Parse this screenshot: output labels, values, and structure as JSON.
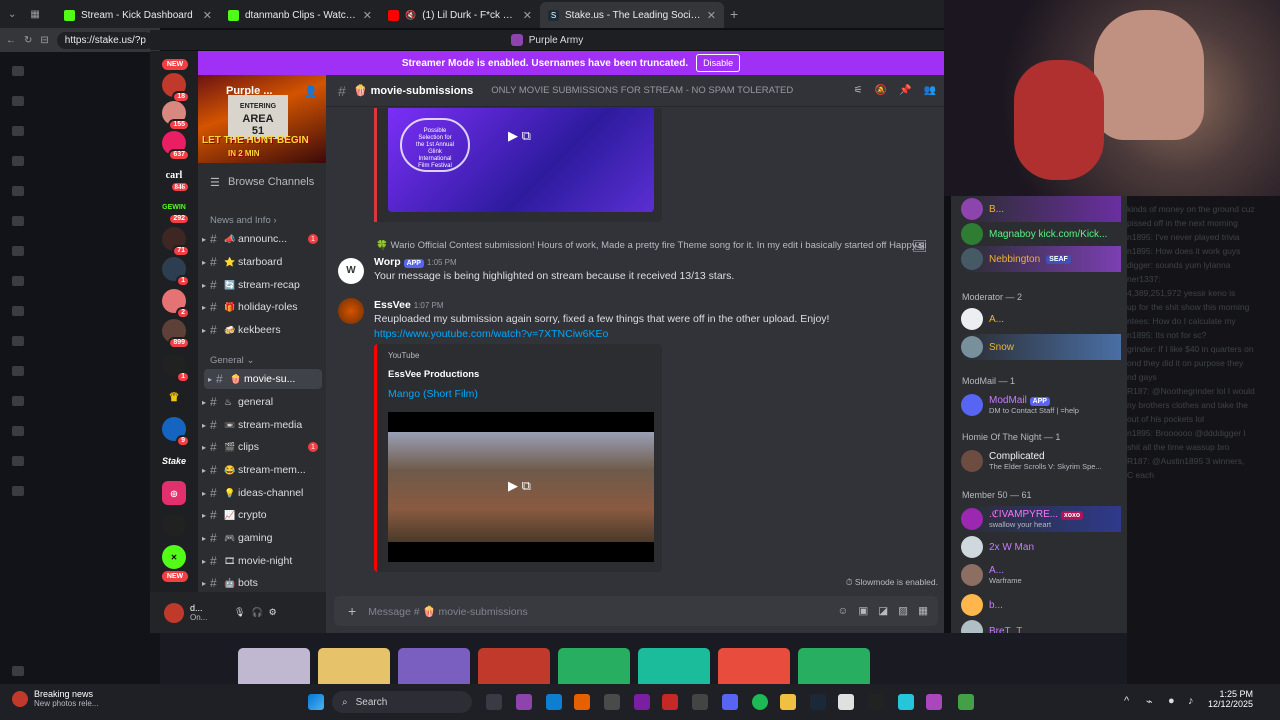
{
  "browser": {
    "tabs": [
      {
        "title": "Stream - Kick Dashboard",
        "color": "#53fc18"
      },
      {
        "title": "dtanmanb Clips - Watch Live on Kick",
        "color": "#53fc18"
      },
      {
        "title": "(1) Lil Durk - F*ck U Thought",
        "color": "#ff0000"
      },
      {
        "title": "Stake.us - The Leading Social Casino",
        "color": "#1a2c38"
      }
    ],
    "url": "https://stake.us/?p"
  },
  "discord": {
    "window_title": "Purple Army",
    "banner_text": "Streamer Mode is enabled. Usernames have been truncated.",
    "banner_button": "Disable",
    "server_name": "Purple ...",
    "server_banner_line1": "ENTERING",
    "server_banner_line2": "AREA",
    "server_banner_line3": "51",
    "server_banner_tagline": "LET THE HUNT BEGIN",
    "server_banner_sub": "IN 2 MIN",
    "browse_channels": "Browse Channels",
    "categories": {
      "news": "News and Info",
      "general": "General"
    },
    "channels": [
      {
        "name": "announc...",
        "emoji": "📣",
        "badge": "1"
      },
      {
        "name": "starboard",
        "emoji": "⭐",
        "badge": ""
      },
      {
        "name": "stream-recap",
        "emoji": "🔄",
        "badge": ""
      },
      {
        "name": "holiday-roles",
        "emoji": "🎁",
        "badge": ""
      },
      {
        "name": "kekbeers",
        "emoji": "🍻",
        "badge": ""
      },
      {
        "name": "movie-su...",
        "emoji": "🍿",
        "badge": ""
      },
      {
        "name": "general",
        "emoji": "♨",
        "badge": ""
      },
      {
        "name": "stream-media",
        "emoji": "📼",
        "badge": ""
      },
      {
        "name": "clips",
        "emoji": "🎬",
        "badge": "1"
      },
      {
        "name": "stream-mem...",
        "emoji": "😂",
        "badge": ""
      },
      {
        "name": "ideas-channel",
        "emoji": "💡",
        "badge": ""
      },
      {
        "name": "crypto",
        "emoji": "📈",
        "badge": ""
      },
      {
        "name": "gaming",
        "emoji": "🎮",
        "badge": ""
      },
      {
        "name": "movie-night",
        "emoji": "🎞",
        "badge": ""
      },
      {
        "name": "bots",
        "emoji": "🤖",
        "badge": ""
      }
    ],
    "guild_badges": [
      "NEW",
      "18",
      "155",
      "637",
      "846",
      "292",
      "71",
      "1",
      "2",
      "899",
      "1",
      "9",
      "NEW"
    ],
    "guild_labels": {
      "carl": "carl",
      "gewin": "GEWIN",
      "stake": "Stake"
    },
    "user_panel": {
      "name": "d...",
      "status": "On..."
    },
    "chat_header": {
      "channel": "movie-submissions",
      "topic": "ONLY MOVIE SUBMISSIONS FOR STREAM - NO SPAM TOLERATED"
    },
    "embed1": {
      "laurel_text": "Possible Selection for the 1st Annual Glink International Film Festival"
    },
    "reply_line": "Wario Official Contest submission! Hours of work, Made a pretty fire Theme song for it. In my edit i basically started off Happy an...",
    "messages": [
      {
        "author": "Worp",
        "tag": "APP",
        "time": "1:05 PM",
        "text": "Your message is being highlighted on stream because it received 13/13 stars.",
        "initial": "W"
      },
      {
        "author": "EssVee",
        "tag": "",
        "time": "1:07 PM",
        "text": "Reuploaded my submission again sorry, fixed a few things that were off in the other upload. Enjoy!",
        "link": "https://www.youtube.com/watch?v=7XTNCiw6KEo"
      }
    ],
    "embed2": {
      "provider": "YouTube",
      "author": "EssVee Productions",
      "title": "Mango (Short Film)"
    },
    "slowmode": "Slowmode is enabled.",
    "message_placeholder": "Message # 🍿 movie-submissions",
    "members": {
      "top": [
        {
          "name": "B...",
          "color": "#f0b232",
          "sub": ""
        },
        {
          "name": "Magnaboy kick.com/Kick...",
          "color": "#57f287",
          "sub": ""
        },
        {
          "name": "Nebbington",
          "color": "#f0b232",
          "sub": "",
          "tag": "SEAF"
        }
      ],
      "moderator_header": "Moderator — 2",
      "moderators": [
        {
          "name": "A...",
          "color": "#f0b232"
        },
        {
          "name": "Snow",
          "color": "#f0b232"
        }
      ],
      "modmail_header": "ModMail — 1",
      "modmail": {
        "name": "ModMail",
        "tag": "APP",
        "sub": "DM to Contact Staff | =help"
      },
      "homie_header": "Homie Of The Night — 1",
      "homie": {
        "name": "Complicated",
        "sub": "The Elder Scrolls V: Skyrim Spe..."
      },
      "member_header": "Member 50 — 61",
      "list": [
        {
          "name": ".ℭIVAMPYRE...",
          "color": "#ff73fa",
          "sub": "swallow your heart",
          "tag": "xoxo"
        },
        {
          "name": "2x W Man",
          "color": "#c97bff",
          "sub": ""
        },
        {
          "name": "A...",
          "color": "#c97bff",
          "sub": "Warframe"
        },
        {
          "name": "b...",
          "color": "#c97bff",
          "sub": ""
        },
        {
          "name": "BreT_T",
          "color": "#c97bff",
          "sub": ""
        }
      ]
    }
  },
  "kick_chat": [
    "kinds of money on the ground cuz",
    "pissed off in the next morning",
    "n1895: I've never played trivia",
    "n1895: How does it work guys",
    "digger: sounds yum lylanna",
    "ner1337:",
    "4,389,251,972 yessir keno is",
    "up for the shit show this morning",
    "ntees: How do I calculate my",
    "n1895: Its not for sc?",
    "grinder: If I like $40 in quarters on",
    "ond they did it on purpose they",
    "nd gays",
    "R187: @Noothegrinder lol I would",
    "ny brothers clothes and take the",
    "out of his pockets lol",
    "n1895: Broooooo @ddddigger I",
    "shit all the time wassup bro",
    "R187: @Austin1895 3 winners,",
    "C each"
  ],
  "taskbar": {
    "news_title": "Breaking news",
    "news_sub": "New photos rele...",
    "search": "Search",
    "time": "1:25 PM",
    "date": "12/12/2025"
  }
}
